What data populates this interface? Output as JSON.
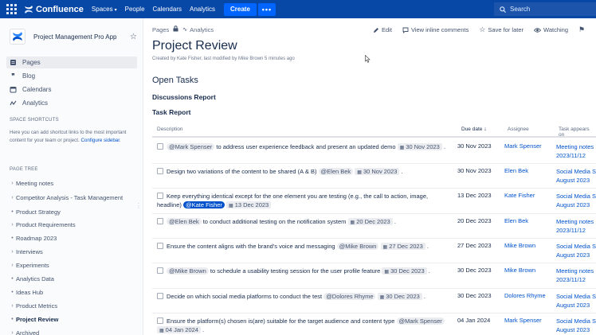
{
  "topnav": {
    "brand": "Confluence",
    "items": [
      {
        "label": "Spaces",
        "caret": "▾"
      },
      {
        "label": "People"
      },
      {
        "label": "Calendars"
      },
      {
        "label": "Analytics"
      }
    ],
    "create_label": "Create",
    "more_label": "•••",
    "search_placeholder": "Search",
    "colors": {
      "bar": "#0747A6",
      "create": "#0065FF"
    }
  },
  "sidebar": {
    "space_name": "Project Management Pro App",
    "links": [
      {
        "label": "Pages",
        "icon": "pages-icon",
        "active": true
      },
      {
        "label": "Blog",
        "icon": "quote-icon"
      },
      {
        "label": "Calendars",
        "icon": "calendar-icon"
      },
      {
        "label": "Analytics",
        "icon": "analytics-icon"
      }
    ],
    "shortcuts_heading": "SPACE SHORTCUTS",
    "shortcuts_text": "Here you can add shortcut links to the most important content for your team or project.",
    "shortcuts_link": "Configure sidebar.",
    "tree_heading": "PAGE TREE",
    "tree": [
      {
        "label": "Meeting notes",
        "bullet": "›"
      },
      {
        "label": "Competitor Analysis - Task Management",
        "bullet": "›"
      },
      {
        "label": "Product Strategy",
        "bullet": "•"
      },
      {
        "label": "Product Requirements",
        "bullet": "›"
      },
      {
        "label": "Roadmap 2023",
        "bullet": "•"
      },
      {
        "label": "Interviews",
        "bullet": "›"
      },
      {
        "label": "Experiments",
        "bullet": "›"
      },
      {
        "label": "Analytics Data",
        "bullet": "•"
      },
      {
        "label": "Ideas Hub",
        "bullet": "•"
      },
      {
        "label": "Product Metrics",
        "bullet": "›"
      },
      {
        "label": "Project Review",
        "bullet": "•",
        "current": true
      },
      {
        "label": "Archived",
        "bullet": "›"
      }
    ]
  },
  "page": {
    "breadcrumb": [
      "Pages",
      "Analytics"
    ],
    "actions": {
      "edit": "Edit",
      "view_comments": "View inline comments",
      "save_later": "Save for later",
      "watching": "Watching"
    },
    "title": "Project Review",
    "byline": "Created by Kate Fisher, last modified by Mike Brown 5 minutes ago",
    "h_open": "Open Tasks",
    "h_discussions": "Discussions Report",
    "h_task": "Task Report"
  },
  "table": {
    "headers": {
      "description": "Description",
      "due": "Due date",
      "sort_arrow": "↓",
      "assignee": "Assignee",
      "appears": "Task appears on"
    },
    "rows": [
      {
        "parts": [
          [
            "m",
            "@Mark Spenser"
          ],
          [
            "t",
            " to address user experience feedback and present an updated demo "
          ],
          [
            "d",
            "30 Nov 2023"
          ],
          [
            "t",
            " ."
          ]
        ],
        "due": "30 Nov 2023",
        "assignee": "Mark Spenser",
        "appears": [
          "Meeting notes",
          "2023/11/12"
        ]
      },
      {
        "parts": [
          [
            "t",
            "Design two variations of the content to be shared (A & B) "
          ],
          [
            "m",
            "@Elen Bek"
          ],
          [
            "t",
            " "
          ],
          [
            "d",
            "30 Nov 2023"
          ],
          [
            "t",
            " ."
          ]
        ],
        "due": "30 Nov 2023",
        "assignee": "Elen Bek",
        "appears": [
          "Social Media S",
          "August 2023"
        ]
      },
      {
        "parts": [
          [
            "t",
            "Keep everything identical except for the one element you are testing (e.g., the call to action, image, headline) "
          ],
          [
            "me",
            "@Kate Fisher"
          ],
          [
            "t",
            " "
          ],
          [
            "d",
            "13 Dec 2023"
          ]
        ],
        "due": "13 Dec 2023",
        "assignee": "Kate Fisher",
        "appears": [
          "Social Media S",
          "August 2023"
        ]
      },
      {
        "parts": [
          [
            "m",
            "@Elen Bek"
          ],
          [
            "t",
            " to conduct additional testing on the notification system "
          ],
          [
            "d",
            "20 Dec 2023"
          ],
          [
            "t",
            " ."
          ]
        ],
        "due": "20 Dec 2023",
        "assignee": "Elen Bek",
        "appears": [
          "Meeting notes",
          "2023/11/12"
        ]
      },
      {
        "parts": [
          [
            "t",
            "Ensure the content aligns with the brand's voice and messaging "
          ],
          [
            "m",
            "@Mike Brown"
          ],
          [
            "t",
            " "
          ],
          [
            "d",
            "27 Dec 2023"
          ],
          [
            "t",
            " ."
          ]
        ],
        "due": "27 Dec 2023",
        "assignee": "Mike Brown",
        "appears": [
          "Social Media S",
          "August 2023"
        ]
      },
      {
        "parts": [
          [
            "m",
            "@Mike Brown"
          ],
          [
            "t",
            " to schedule a usability testing session for the user profile feature "
          ],
          [
            "d",
            "30 Dec 2023"
          ],
          [
            "t",
            " ."
          ]
        ],
        "due": "30 Dec 2023",
        "assignee": "Mike Brown",
        "appears": [
          "Meeting notes",
          "2023/11/12"
        ]
      },
      {
        "parts": [
          [
            "t",
            "Decide on which social media platforms to conduct the test "
          ],
          [
            "m",
            "@Dolores Rhyme"
          ],
          [
            "t",
            " "
          ],
          [
            "d",
            "30 Dec 2023"
          ],
          [
            "t",
            " ."
          ]
        ],
        "due": "30 Dec 2023",
        "assignee": "Dolores Rhyme",
        "appears": [
          "Social Media S",
          "August 2023"
        ]
      },
      {
        "parts": [
          [
            "t",
            "Ensure the platform(s) chosen is(are) suitable for the target audience and content type "
          ],
          [
            "m",
            "@Mark Spenser"
          ],
          [
            "t",
            " "
          ],
          [
            "d",
            "04 Jan 2024"
          ],
          [
            "t",
            " ."
          ]
        ],
        "due": "04 Jan 2024",
        "assignee": "Mark Spenser",
        "appears": [
          "Social Media S",
          "August 2023"
        ]
      }
    ]
  }
}
